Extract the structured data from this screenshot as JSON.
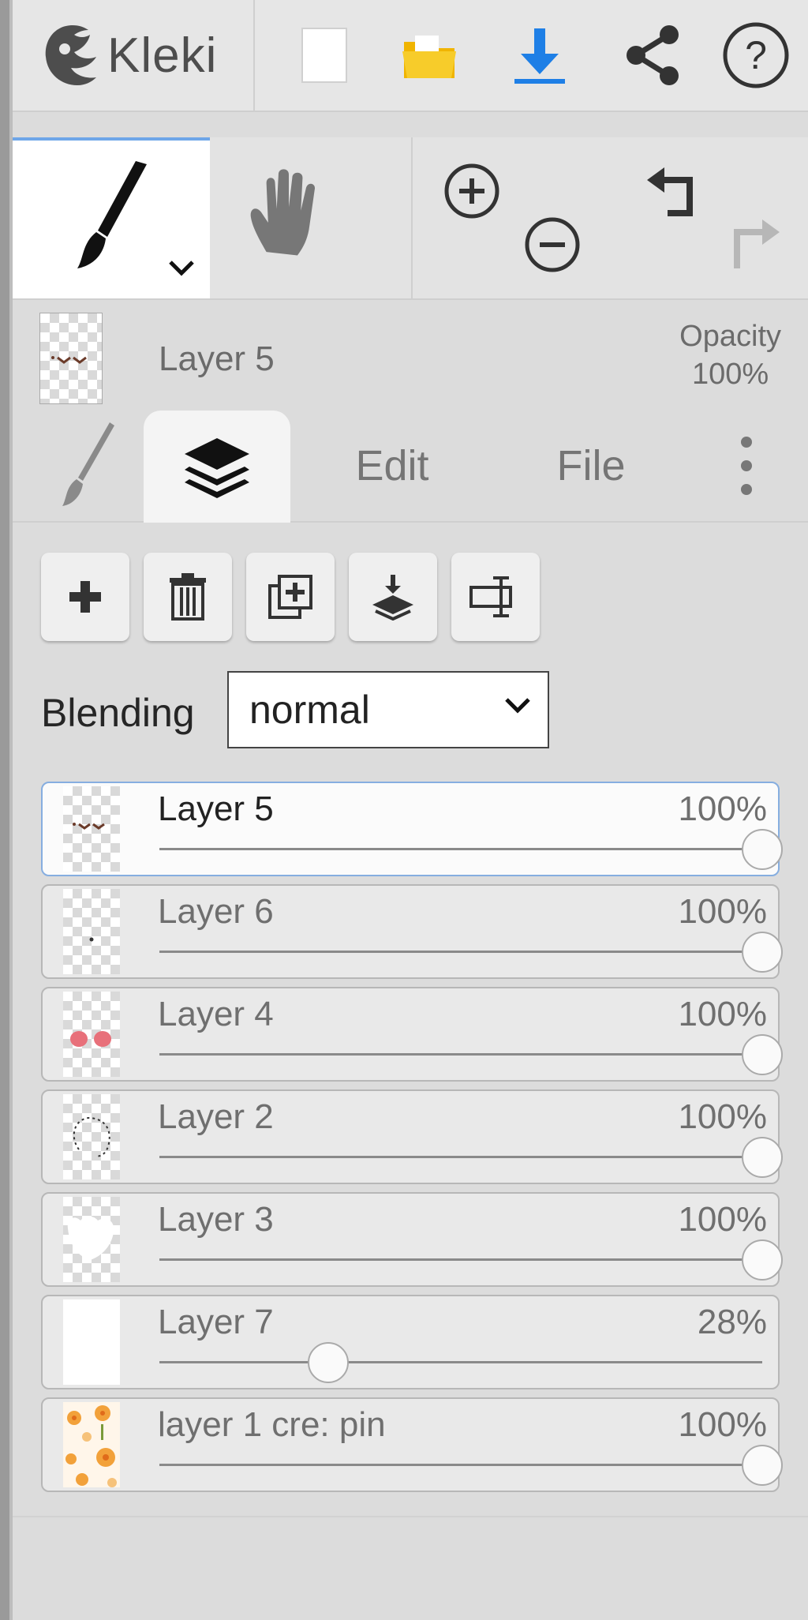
{
  "app": {
    "logo_text": "Kleki"
  },
  "topbar": {
    "buttons": [
      "new-image",
      "open-file",
      "save-download",
      "share",
      "help"
    ],
    "accent_color": "#1e7fe6",
    "folder_color": "#f5c518"
  },
  "tools": {
    "active": "brush",
    "items": [
      "brush",
      "hand",
      "zoom-in",
      "zoom-out",
      "undo",
      "redo"
    ]
  },
  "current_layer": {
    "name": "Layer 5",
    "opacity_label": "Opacity",
    "opacity_value": "100%"
  },
  "tabs": {
    "edit": "Edit",
    "file": "File",
    "active": "layers"
  },
  "layer_actions": [
    "add-layer",
    "delete-layer",
    "duplicate-layer",
    "merge-down",
    "rename-layer"
  ],
  "blending": {
    "label": "Blending",
    "value": "normal"
  },
  "layers": [
    {
      "name": "Layer 5",
      "opacity": "100%",
      "opacity_value": 1.0,
      "active": true
    },
    {
      "name": "Layer 6",
      "opacity": "100%",
      "opacity_value": 1.0,
      "active": false
    },
    {
      "name": "Layer 4",
      "opacity": "100%",
      "opacity_value": 1.0,
      "active": false
    },
    {
      "name": "Layer 2",
      "opacity": "100%",
      "opacity_value": 1.0,
      "active": false
    },
    {
      "name": "Layer 3",
      "opacity": "100%",
      "opacity_value": 1.0,
      "active": false
    },
    {
      "name": "Layer 7",
      "opacity": "28%",
      "opacity_value": 0.28,
      "active": false
    },
    {
      "name": "layer 1 cre: pin",
      "opacity": "100%",
      "opacity_value": 1.0,
      "active": false
    }
  ]
}
